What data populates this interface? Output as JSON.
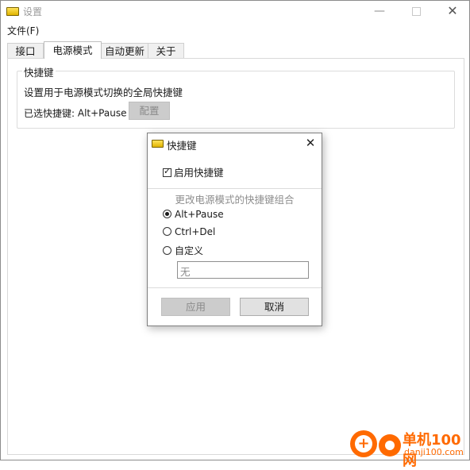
{
  "window": {
    "title": "设置",
    "minimize_glyph": "—",
    "close_glyph": "✕"
  },
  "menu": {
    "file": "文件(F)"
  },
  "tabs": [
    {
      "label": "接口"
    },
    {
      "label": "电源模式"
    },
    {
      "label": "自动更新"
    },
    {
      "label": "关于"
    }
  ],
  "active_tab": "电源模式",
  "hotkey_group": {
    "legend": "快捷键",
    "description": "设置用于电源模式切换的全局快捷键",
    "selected_label": "已选快捷键:",
    "selected_value": "Alt+Pause",
    "config_button": "配置"
  },
  "dialog": {
    "title": "快捷键",
    "close_glyph": "✕",
    "enable_checkbox": {
      "label": "启用快捷键",
      "checked": true,
      "mark": "✓"
    },
    "combo_label": "更改电源模式的快捷键组合",
    "options": [
      {
        "label": "Alt+Pause",
        "selected": true
      },
      {
        "label": "Ctrl+Del",
        "selected": false
      },
      {
        "label": "自定义",
        "selected": false
      }
    ],
    "custom_value": "无",
    "apply_button": "应用",
    "cancel_button": "取消"
  },
  "watermark": {
    "logo_glyph": "+",
    "title": "单机100网",
    "url": "danji100.com",
    "color": "#ff6a00"
  },
  "colors": {
    "disabled_button_bg": "#cccccc",
    "disabled_text": "#8a8a8a"
  }
}
